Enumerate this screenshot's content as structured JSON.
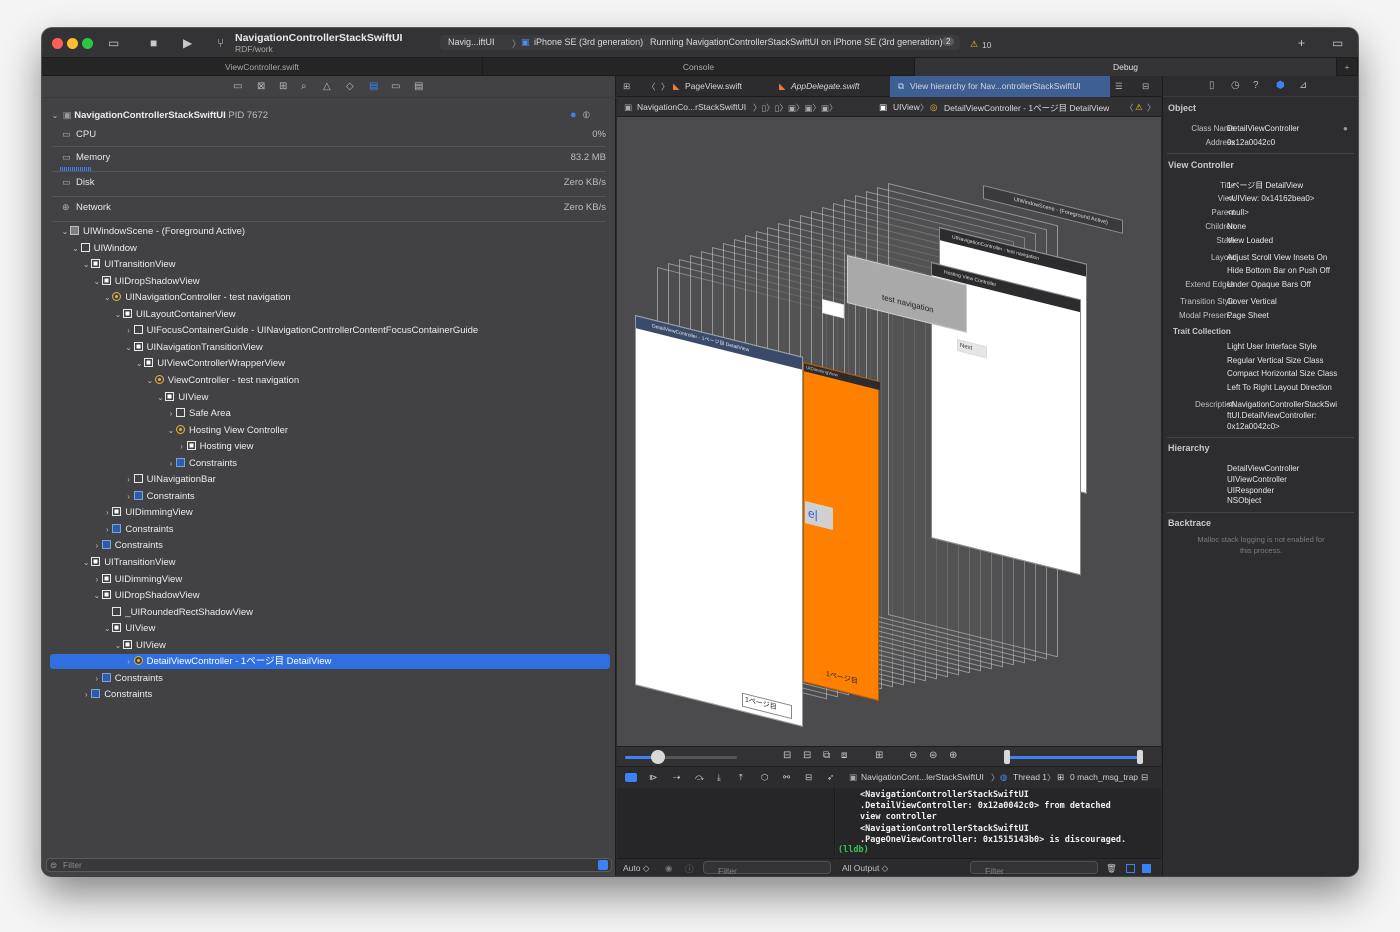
{
  "toolbar": {
    "project_title": "NavigationControllerStackSwiftUI",
    "project_subtitle": "RDF/work",
    "scheme_target": "Navig...iftUI",
    "device": "iPhone SE (3rd generation)",
    "status": "Running NavigationControllerStackSwiftUI on iPhone SE (3rd generation)",
    "status_count": "2",
    "warnings": "10"
  },
  "tabs": {
    "left": "ViewController.swift",
    "middle": "Console",
    "right": "Debug"
  },
  "process": {
    "name": "NavigationControllerStackSwiftUI",
    "pid": "PID 7672",
    "cpu_label": "CPU",
    "cpu_value": "0%",
    "memory_label": "Memory",
    "memory_value": "83.2 MB",
    "disk_label": "Disk",
    "disk_value": "Zero KB/s",
    "network_label": "Network",
    "network_value": "Zero KB/s"
  },
  "tree": [
    {
      "label": "UIWindowScene - (Foreground Active)",
      "indent": 0,
      "chev": "v",
      "kind": "scene"
    },
    {
      "label": "UIWindow",
      "indent": 1,
      "chev": "v",
      "kind": "dark"
    },
    {
      "label": "UITransitionView",
      "indent": 2,
      "chev": "v",
      "kind": "view"
    },
    {
      "label": "UIDropShadowView",
      "indent": 3,
      "chev": "v",
      "kind": "view"
    },
    {
      "label": "UINavigationController - test navigation",
      "indent": 4,
      "chev": "v",
      "kind": "vc"
    },
    {
      "label": "UILayoutContainerView",
      "indent": 5,
      "chev": "v",
      "kind": "view"
    },
    {
      "label": "UIFocusContainerGuide - UINavigationControllerContentFocusContainerGuide",
      "indent": 6,
      "chev": ">",
      "kind": "dark"
    },
    {
      "label": "UINavigationTransitionView",
      "indent": 6,
      "chev": "v",
      "kind": "view"
    },
    {
      "label": "UIViewControllerWrapperView",
      "indent": 7,
      "chev": "v",
      "kind": "view"
    },
    {
      "label": "ViewController - test navigation",
      "indent": 8,
      "chev": "v",
      "kind": "vc"
    },
    {
      "label": "UIView",
      "indent": 9,
      "chev": "v",
      "kind": "view"
    },
    {
      "label": "Safe Area",
      "indent": 10,
      "chev": ">",
      "kind": "dark"
    },
    {
      "label": "Hosting View Controller",
      "indent": 10,
      "chev": "v",
      "kind": "vc"
    },
    {
      "label": "Hosting view",
      "indent": 11,
      "chev": ">",
      "kind": "view"
    },
    {
      "label": "Constraints",
      "indent": 10,
      "chev": ">",
      "kind": "cons"
    },
    {
      "label": "UINavigationBar",
      "indent": 6,
      "chev": ">",
      "kind": "dark"
    },
    {
      "label": "Constraints",
      "indent": 6,
      "chev": ">",
      "kind": "cons"
    },
    {
      "label": "UIDimmingView",
      "indent": 4,
      "chev": ">",
      "kind": "view"
    },
    {
      "label": "Constraints",
      "indent": 4,
      "chev": ">",
      "kind": "cons"
    },
    {
      "label": "Constraints",
      "indent": 3,
      "chev": ">",
      "kind": "cons"
    },
    {
      "label": "UITransitionView",
      "indent": 2,
      "chev": "v",
      "kind": "view"
    },
    {
      "label": "UIDimmingView",
      "indent": 3,
      "chev": ">",
      "kind": "view"
    },
    {
      "label": "UIDropShadowView",
      "indent": 3,
      "chev": "v",
      "kind": "view"
    },
    {
      "label": "_UIRoundedRectShadowView",
      "indent": 4,
      "chev": "",
      "kind": "dark"
    },
    {
      "label": "UIView",
      "indent": 4,
      "chev": "v",
      "kind": "view"
    },
    {
      "label": "UIView",
      "indent": 5,
      "chev": "v",
      "kind": "view"
    },
    {
      "label": "DetailViewController - 1ページ目 DetailView",
      "indent": 6,
      "chev": ">",
      "kind": "vc",
      "selected": true
    },
    {
      "label": "Constraints",
      "indent": 3,
      "chev": ">",
      "kind": "cons"
    },
    {
      "label": "Constraints",
      "indent": 2,
      "chev": ">",
      "kind": "cons"
    }
  ],
  "left_filter": "Filter",
  "editor_tabs": {
    "file1": "PageView.swift",
    "file2": "AppDelegate.swift",
    "file3": "View hierarchy for Nav...ontrollerStackSwiftUI"
  },
  "jumpbar": {
    "root": "NavigationCo...rStackSwiftUI",
    "view": "UIView",
    "detail": "DetailViewController - 1ページ目 DetailView"
  },
  "canvas": {
    "scene_label": "UIWindowScene - (Foreground Active)",
    "nav_label": "UINavigationController - test navigation",
    "vc_label": "ViewController - test navigation",
    "hosting_label": "Hosting View Controller",
    "nav_title": "test navigation",
    "detail_header": "DetailViewController - 1ページ目 DetailView",
    "dimming": "UIDimmingView",
    "page_label_orange": "1ページ目",
    "page_label_white": "1ページ目",
    "button_text": "e|",
    "next_text": "Next"
  },
  "debugbar": {
    "process": "NavigationCont...lerStackSwiftUI",
    "thread": "Thread 1",
    "frame": "0 mach_msg_trap"
  },
  "console": {
    "lines": [
      "<NavigationControllerStackSwiftUI",
      ".DetailViewController: 0x12a0042c0> from detached",
      "view controller",
      "<NavigationControllerStackSwiftUI",
      ".PageOneViewController: 0x1515143b0> is discouraged."
    ],
    "prompt": "(lldb)",
    "auto_label": "Auto ◇",
    "left_filter": "Filter",
    "output_label": "All Output ◇",
    "right_filter": "Filter"
  },
  "inspector": {
    "object_header": "Object",
    "class_name_k": "Class Name",
    "class_name_v": "DetailViewController",
    "address_k": "Address",
    "address_v": "0x12a0042c0",
    "vc_header": "View Controller",
    "title_k": "Title",
    "title_v": "1ページ目 DetailView",
    "view_k": "View",
    "view_v": "<UIView: 0x14162bea0>",
    "parent_k": "Parent",
    "parent_v": "<null>",
    "children_k": "Children",
    "children_v": "None",
    "state_k": "State",
    "state_v": "View Loaded",
    "layout_k": "Layout",
    "layout_v1": "Adjust Scroll View Insets On",
    "layout_v2": "Hide Bottom Bar on Push Off",
    "extend_k": "Extend Edges",
    "extend_v": "Under Opaque Bars Off",
    "transition_k": "Transition Style",
    "transition_v": "Cover Vertical",
    "modal_k": "Modal Presen...",
    "modal_v": "Page Sheet",
    "trait_header": "Trait Collection",
    "trait_1": "Light User Interface Style",
    "trait_2": "Regular Vertical Size Class",
    "trait_3": "Compact Horizontal Size Class",
    "trait_4": "Left To Right Layout Direction",
    "desc_k": "Description",
    "desc_1": "<NavigationControllerStackSwi",
    "desc_2": "ftUI.DetailViewController:",
    "desc_3": "0x12a0042c0>",
    "hierarchy_header": "Hierarchy",
    "h1": "DetailViewController",
    "h2": "UIViewController",
    "h3": "UIResponder",
    "h4": "NSObject",
    "backtrace_header": "Backtrace",
    "backtrace_1": "Malloc stack logging is not enabled for",
    "backtrace_2": "this process."
  },
  "colors": {
    "accent": "#2f6fe0",
    "orange": "#ff8000",
    "lldb_green": "#39c45b"
  }
}
